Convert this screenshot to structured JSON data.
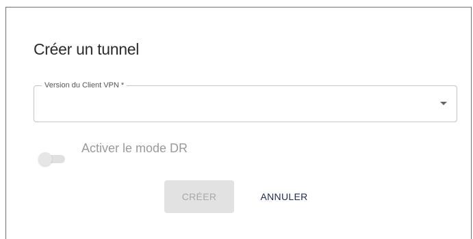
{
  "dialog": {
    "title": "Créer un tunnel",
    "vpn_select": {
      "label": "Version du Client VPN *",
      "value": ""
    },
    "dr_toggle": {
      "label": "Activer le mode DR",
      "checked": false
    },
    "buttons": {
      "create_label": "CRÉER",
      "cancel_label": "ANNULER"
    }
  }
}
